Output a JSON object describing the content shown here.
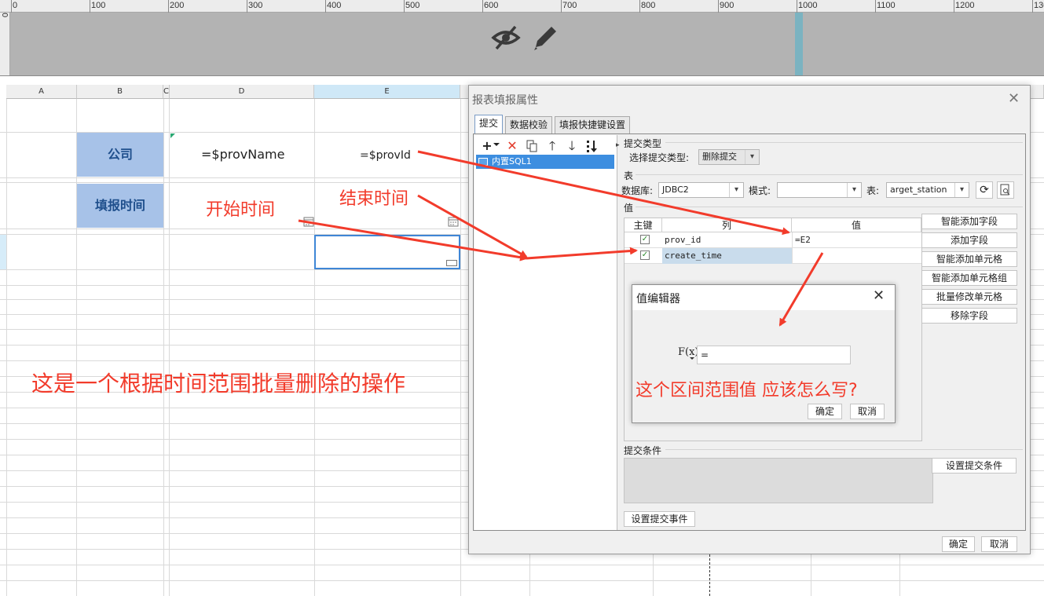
{
  "ruler": {
    "labels": [
      "0",
      "100",
      "200",
      "300",
      "400",
      "500",
      "600",
      "700",
      "800",
      "900",
      "1000",
      "1100",
      "1200",
      "1300"
    ],
    "vertical_label": "0"
  },
  "band": {
    "icons": [
      "eye-slash-icon",
      "pencil-icon"
    ]
  },
  "sheet": {
    "columns": [
      "A",
      "B",
      "C",
      "D",
      "E"
    ],
    "cells": {
      "company_label": "公司",
      "prov_name": "=$provName",
      "prov_id": "=$provId",
      "fill_time_label": "填报时间"
    }
  },
  "annotations": {
    "start_time": "开始时间",
    "end_time": "结束时间",
    "batch_delete_note": "这是一个根据时间范围批量删除的操作",
    "range_question": "这个区间范围值 应该怎么写?"
  },
  "dialog": {
    "title": "报表填报属性",
    "tabs": [
      "提交",
      "数据校验",
      "填报快捷键设置"
    ],
    "tree_item": "内置SQL1",
    "submit_type_section": "提交类型",
    "choose_submit_type_label": "选择提交类型:",
    "submit_type_value": "删除提交",
    "table_section": "表",
    "database_label": "数据库:",
    "database_value": "JDBC2",
    "schema_label": "模式:",
    "schema_value": "",
    "table_label": "表:",
    "table_value": "arget_station",
    "value_section": "值",
    "table_headers": {
      "key": "主键",
      "column": "列",
      "value": "值"
    },
    "rows": [
      {
        "checked": true,
        "column": "prov_id",
        "value": "=E2"
      },
      {
        "checked": true,
        "column": "create_time",
        "value": ""
      }
    ],
    "side_buttons": [
      "智能添加字段",
      "添加字段",
      "智能添加单元格",
      "智能添加单元格组",
      "批量修改单元格",
      "移除字段"
    ],
    "submit_condition_section": "提交条件",
    "set_condition_button": "设置提交条件",
    "set_event_button": "设置提交事件",
    "ok_button": "确定",
    "cancel_button": "取消"
  },
  "value_editor": {
    "title": "值编辑器",
    "fx_label": "F(x)",
    "input_value": "=",
    "ok_button": "确定",
    "cancel_button": "取消"
  },
  "colors": {
    "annotation_red": "#f23b2b",
    "header_blue": "#a7c2e8",
    "selection_blue": "#3d8ee0"
  }
}
